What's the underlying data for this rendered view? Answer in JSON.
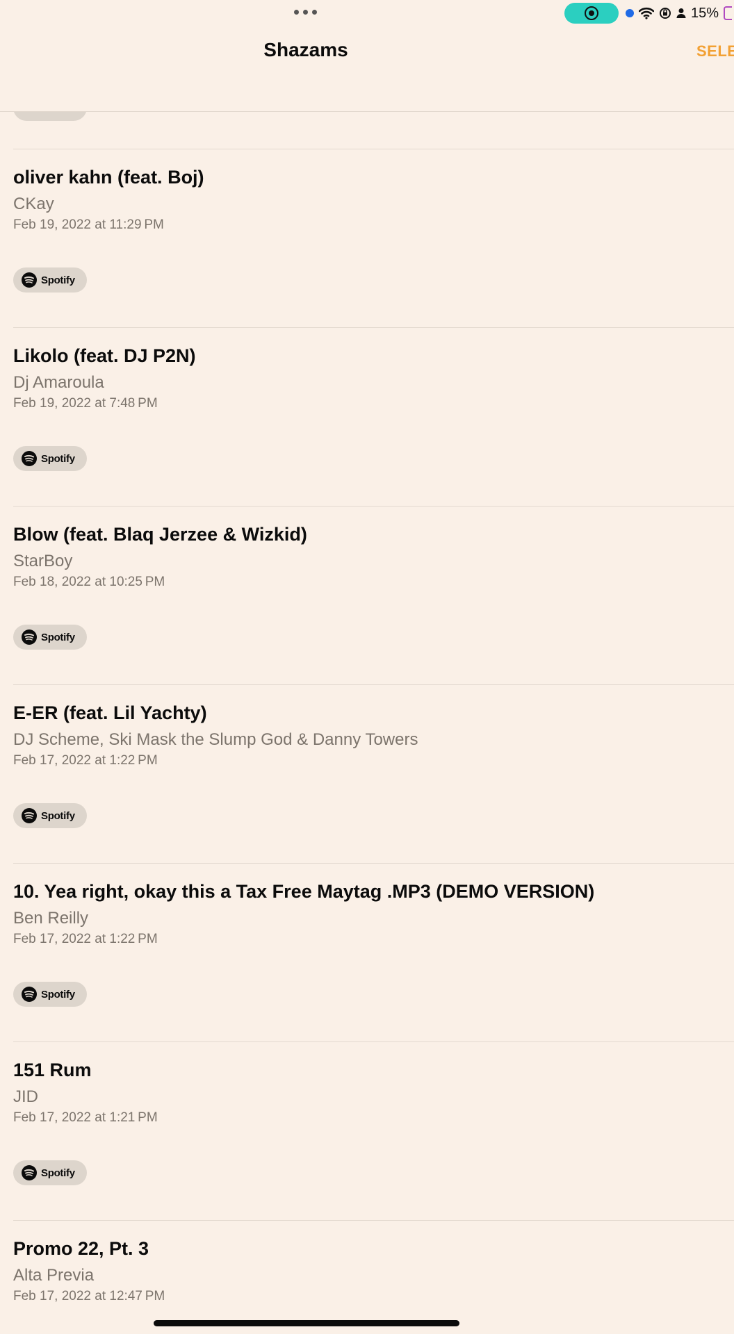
{
  "status_bar": {
    "battery_text": "15%",
    "icons": [
      "more-dots-icon",
      "screen-record-icon",
      "location-dot-icon",
      "wifi-icon",
      "orientation-lock-icon",
      "person-icon",
      "battery-icon"
    ]
  },
  "header": {
    "title": "Shazams",
    "select_label": "SELE"
  },
  "spotify_label": "Spotify",
  "items": [
    {
      "title": "oliver kahn (feat. Boj)",
      "artist": "CKay",
      "date": "Feb 19, 2022 at 11:29 PM"
    },
    {
      "title": "Likolo (feat. DJ P2N)",
      "artist": "Dj Amaroula",
      "date": "Feb 19, 2022 at 7:48 PM"
    },
    {
      "title": "Blow (feat. Blaq Jerzee & Wizkid)",
      "artist": "StarBoy",
      "date": "Feb 18, 2022 at 10:25 PM"
    },
    {
      "title": "E-ER (feat. Lil Yachty)",
      "artist": "DJ Scheme, Ski Mask the Slump God & Danny Towers",
      "date": "Feb 17, 2022 at 1:22 PM"
    },
    {
      "title": "10. Yea right, okay this a Tax Free Maytag .MP3 (DEMO VERSION)",
      "artist": "Ben Reilly",
      "date": "Feb 17, 2022 at 1:22 PM"
    },
    {
      "title": "151 Rum",
      "artist": "JID",
      "date": "Feb 17, 2022 at 1:21 PM"
    },
    {
      "title": "Promo 22, Pt. 3",
      "artist": "Alta Previa",
      "date": "Feb 17, 2022 at 12:47 PM"
    }
  ],
  "colors": {
    "background": "#faf0e7",
    "accent": "#f2a033",
    "record_pill": "#2bcfc0",
    "chip": "#ddd5cc",
    "secondary_text": "#7c746c"
  }
}
